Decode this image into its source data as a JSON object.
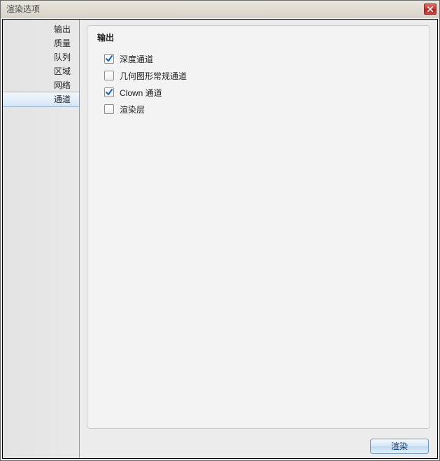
{
  "window": {
    "title": "渲染选项"
  },
  "sidebar": {
    "items": [
      {
        "label": "输出",
        "selected": false
      },
      {
        "label": "质量",
        "selected": false
      },
      {
        "label": "队列",
        "selected": false
      },
      {
        "label": "区域",
        "selected": false
      },
      {
        "label": "网络",
        "selected": false
      },
      {
        "label": "通道",
        "selected": true
      }
    ]
  },
  "panel": {
    "title": "输出",
    "checks": [
      {
        "label": "深度通道",
        "checked": true
      },
      {
        "label": "几何图形常规通道",
        "checked": false
      },
      {
        "label": "Clown 通道",
        "checked": true
      },
      {
        "label": "渲染层",
        "checked": false
      }
    ]
  },
  "footer": {
    "render_label": "渲染"
  }
}
